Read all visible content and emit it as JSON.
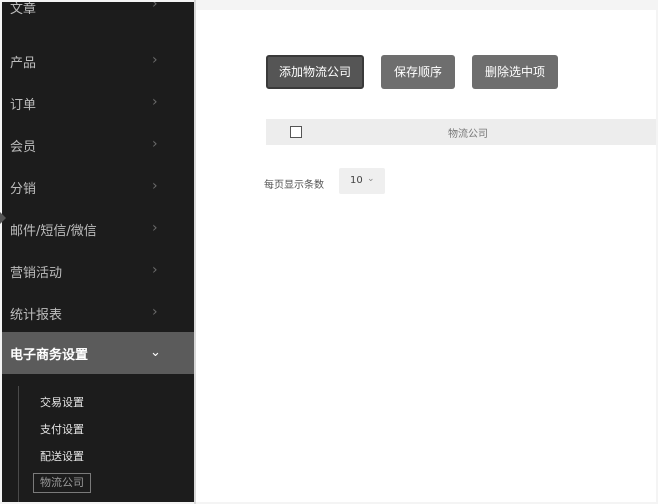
{
  "sidebar": {
    "items": [
      {
        "label": "文章"
      },
      {
        "label": "产品"
      },
      {
        "label": "订单"
      },
      {
        "label": "会员"
      },
      {
        "label": "分销"
      },
      {
        "label": "邮件/短信/微信"
      },
      {
        "label": "营销活动"
      },
      {
        "label": "统计报表"
      },
      {
        "label": "电子商务设置"
      }
    ],
    "chevron_right": "›",
    "chevron_down": "⌄",
    "sub_items": [
      {
        "label": "交易设置"
      },
      {
        "label": "支付设置"
      },
      {
        "label": "配送设置"
      },
      {
        "label": "物流公司"
      }
    ]
  },
  "toolbar": {
    "add_label": "添加物流公司",
    "save_order_label": "保存顺序",
    "delete_selected_label": "删除选中项"
  },
  "table": {
    "columns": [
      "物流公司"
    ]
  },
  "pager": {
    "per_page_label": "每页显示条数",
    "per_page_value": "10",
    "chevron": "⌄"
  },
  "colors": {
    "sidebar_bg": "#1c1c1c",
    "sidebar_active_bg": "#5b5b5b",
    "button_bg": "#6e6e6e"
  }
}
